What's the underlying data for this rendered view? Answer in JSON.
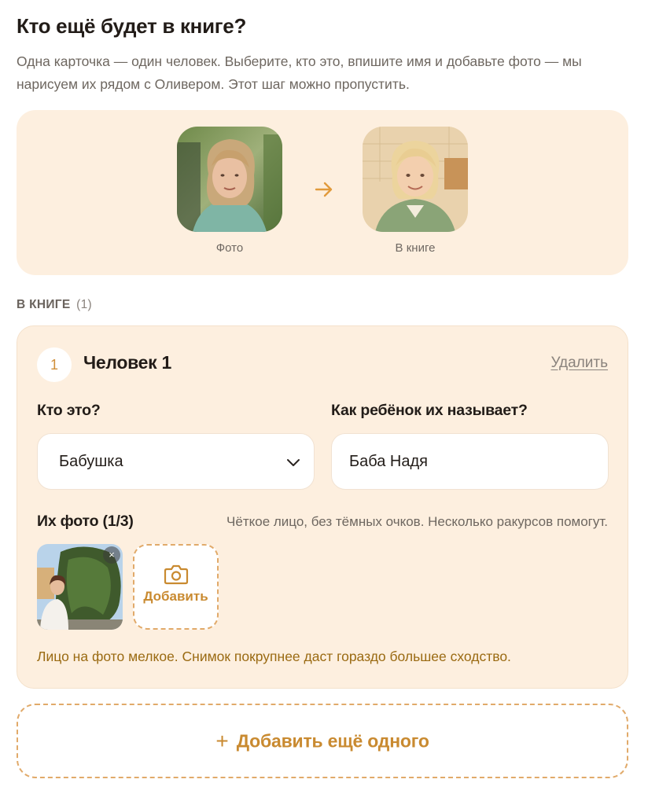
{
  "header": {
    "title": "Кто ещё будет в книге?",
    "subtitle": "Одна карточка — один человек. Выберите, кто это, впишите имя и добавьте фото — мы нарисуем их рядом с Оливером. Этот шаг можно пропустить."
  },
  "example": {
    "photo_caption": "Фото",
    "book_caption": "В книге",
    "arrow_icon": "arrow-right-icon",
    "accent": "#e19a3c"
  },
  "section": {
    "heading": "В КНИГЕ",
    "count": "(1)"
  },
  "person": {
    "number": "1",
    "title": "Человек 1",
    "delete_label": "Удалить",
    "who_label": "Кто это?",
    "who_value": "Бабушка",
    "name_label": "Как ребёнок их называет?",
    "name_value": "Баба Надя",
    "photos_label": "Их фото (1/3)",
    "photos_hint": "Чёткое лицо, без тёмных очков. Несколько ракурсов помогут.",
    "remove_symbol": "×",
    "add_photo_label": "Добавить",
    "warning": "Лицо на фото мелкое. Снимок покрупнее даст гораздо большее сходство."
  },
  "add_more": {
    "plus": "+",
    "label": "Добавить ещё одного"
  },
  "colors": {
    "panel_bg": "#fdefdf",
    "accent": "#c98a30",
    "warning": "#9a6a12"
  }
}
